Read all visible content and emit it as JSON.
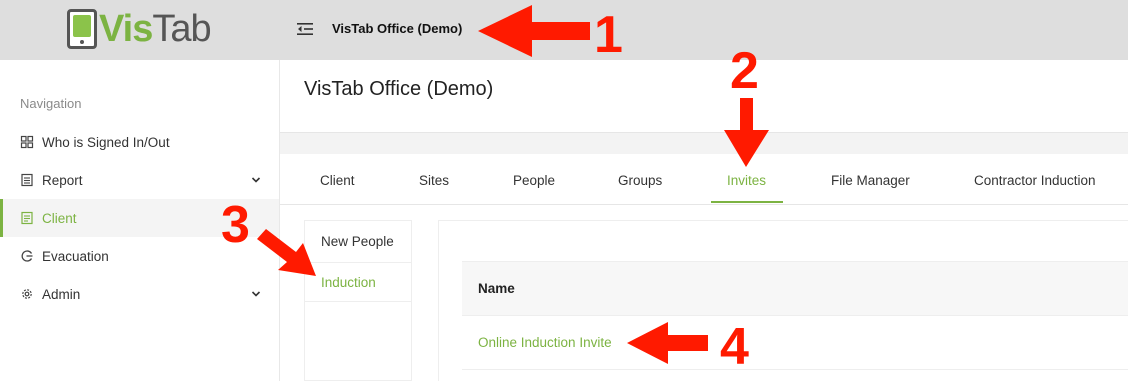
{
  "header": {
    "logo": {
      "part1": "Vis",
      "part2": "Tab"
    },
    "title": "VisTab Office (Demo)",
    "menu_icon": "menu-collapse-icon"
  },
  "sidebar": {
    "heading": "Navigation",
    "items": [
      {
        "label": "Who is Signed In/Out",
        "icon": "grid-icon",
        "has_submenu": false,
        "active": false
      },
      {
        "label": "Report",
        "icon": "report-icon",
        "has_submenu": true,
        "active": false
      },
      {
        "label": "Client",
        "icon": "document-icon",
        "has_submenu": false,
        "active": true
      },
      {
        "label": "Evacuation",
        "icon": "evacuation-icon",
        "has_submenu": false,
        "active": false
      },
      {
        "label": "Admin",
        "icon": "gear-icon",
        "has_submenu": true,
        "active": false
      }
    ]
  },
  "main": {
    "page_title": "VisTab Office (Demo)",
    "tabs": [
      {
        "label": "Client",
        "active": false
      },
      {
        "label": "Sites",
        "active": false
      },
      {
        "label": "People",
        "active": false
      },
      {
        "label": "Groups",
        "active": false
      },
      {
        "label": "Invites",
        "active": true
      },
      {
        "label": "File Manager",
        "active": false
      },
      {
        "label": "Contractor Induction",
        "active": false
      }
    ],
    "subnav": [
      {
        "label": "New People",
        "active": false
      },
      {
        "label": "Induction",
        "active": true
      }
    ],
    "table": {
      "columns": [
        "Name"
      ],
      "rows": [
        {
          "name": "Online Induction Invite"
        }
      ]
    }
  },
  "annotations": {
    "numbers": [
      "1",
      "2",
      "3",
      "4"
    ],
    "color": "#ff1a00"
  },
  "colors": {
    "accent": "#7cb342",
    "header_bg": "#dedede",
    "annotation": "#ff1a00"
  }
}
